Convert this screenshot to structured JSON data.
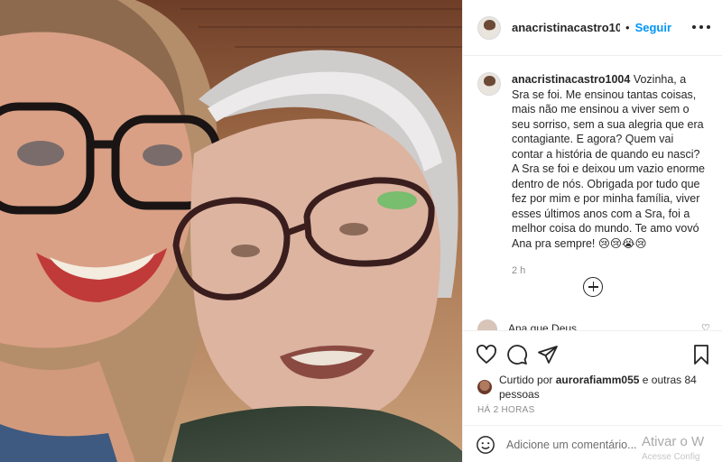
{
  "post": {
    "username": "anacristinacastro1004",
    "separator": "•",
    "follow_label": "Seguir",
    "caption_username": "anacristinacastro1004",
    "caption_text": " Vozinha, a Sra se foi. Me ensinou tantas coisas, mais não me ensinou a viver sem o seu sorriso, sem a sua alegria que era contagiante. E agora? Quem vai contar a história de quando eu nasci? A Sra se foi e deixou um vazio enorme dentro de nós. Obrigada por tudo que fez por mim e por minha família, viver esses últimos anos com a Sra, foi a melhor coisa do mundo. Te amo vovó Ana pra sempre! 😢😢😭😢",
    "caption_time": "2 h",
    "partial_comment": "Ana que Deus",
    "liked_prefix": "Curtido por ",
    "liked_user": "aurorafiamm055",
    "liked_suffix": " e outras 84 pessoas",
    "date_label": "HÁ 2 HORAS",
    "comment_placeholder": "Adicione um comentário...",
    "watermark": "Ativar o W",
    "watermark_sub": "Acesse Config"
  },
  "icons": {
    "more": "more-options-icon",
    "like": "heart-icon",
    "comment": "comment-icon",
    "share": "paper-plane-icon",
    "save": "bookmark-icon",
    "load_more": "plus-circle-icon",
    "emoji": "smiley-icon"
  },
  "colors": {
    "accent": "#0095f6",
    "text": "#262626",
    "secondary": "#8e8e8e",
    "border": "#efefef"
  }
}
